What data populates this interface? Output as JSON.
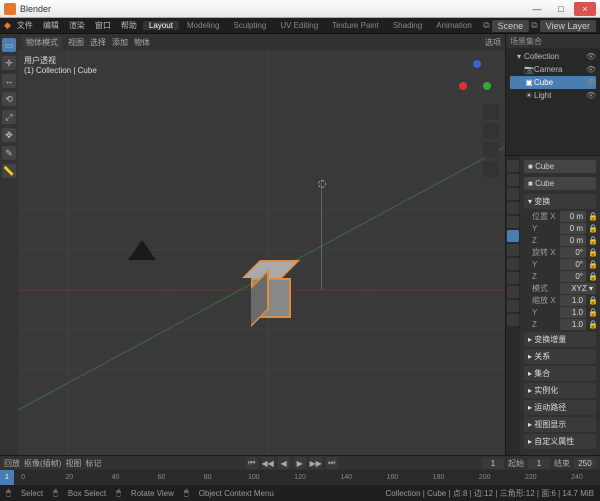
{
  "window": {
    "title": "Blender",
    "min": "—",
    "max": "□",
    "close": "×"
  },
  "menu": [
    "文件",
    "编辑",
    "渲染",
    "窗口",
    "帮助"
  ],
  "workspaces": [
    "Layout",
    "Modeling",
    "Sculpting",
    "UV Editing",
    "Texture Paint",
    "Shading",
    "Animation"
  ],
  "active_workspace": "Layout",
  "scene_row": {
    "scene_label": "Scene",
    "viewlayer_label": "View Layer"
  },
  "viewport": {
    "mode": "物体模式",
    "menu": [
      "视图",
      "选择",
      "添加",
      "物体"
    ],
    "options_label": "选项",
    "persp_label": "用户透视",
    "context_label": "(1) Collection | Cube"
  },
  "outliner": {
    "title": "场景集合",
    "items": [
      {
        "label": "Collection",
        "indent": 0,
        "sel": false,
        "ic": "▾"
      },
      {
        "label": "Camera",
        "indent": 1,
        "sel": false,
        "ic": "📷"
      },
      {
        "label": "Cube",
        "indent": 1,
        "sel": true,
        "ic": "▣"
      },
      {
        "label": "Light",
        "indent": 1,
        "sel": false,
        "ic": "☀"
      }
    ]
  },
  "properties": {
    "name": "Cube",
    "name2": "Cube",
    "transform": "变换",
    "loc_label": "位置",
    "loc": [
      "0 m",
      "0 m",
      "0 m"
    ],
    "rot_label": "旋转",
    "rot": [
      "0°",
      "0°",
      "0°"
    ],
    "mode_label": "模式",
    "mode_val": "XYZ",
    "scale_label": "缩放",
    "scale": [
      "1.0",
      "1.0",
      "1.0"
    ],
    "axes": [
      "X",
      "Y",
      "Z"
    ],
    "panels": [
      "变换增量",
      "关系",
      "集合",
      "实例化",
      "运动路径",
      "视图显示",
      "自定义属性"
    ]
  },
  "timeline": {
    "menu": [
      "回放",
      "抠像(插帧)",
      "视图",
      "标记"
    ],
    "frame_current": "1",
    "start_label": "起始",
    "start": "1",
    "end_label": "结束",
    "end": "250",
    "ticks": [
      "0",
      "20",
      "40",
      "60",
      "80",
      "100",
      "120",
      "140",
      "160",
      "180",
      "200",
      "220",
      "240"
    ]
  },
  "status": {
    "select": "Select",
    "box": "Box Select",
    "rotate": "Rotate View",
    "context": "Object Context Menu",
    "right": "Collection | Cube | 点:8 | 边:12 | 三角形:12 | 面:6 | 14.7 MiB"
  }
}
